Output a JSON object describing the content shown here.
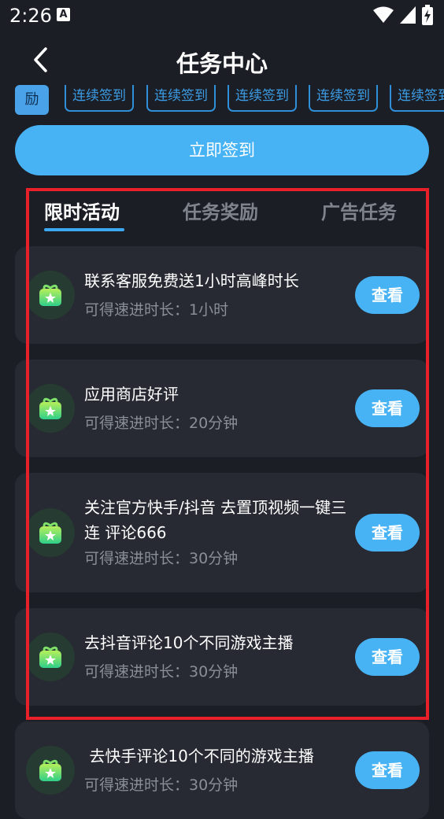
{
  "status": {
    "time": "2:26",
    "notification_icon": "A"
  },
  "header": {
    "title": "任务中心"
  },
  "chips": {
    "first": "励",
    "items": [
      "连续签到",
      "连续签到",
      "连续签到",
      "连续签到",
      "连续签到"
    ]
  },
  "signin": {
    "label": "立即签到"
  },
  "tabs": [
    {
      "label": "限时活动",
      "active": true
    },
    {
      "label": "任务奖励",
      "active": false
    },
    {
      "label": "广告任务",
      "active": false
    }
  ],
  "tasks": [
    {
      "title": "联系客服免费送1小时高峰时长",
      "reward": "可得速进时长：1小时",
      "button": "查看"
    },
    {
      "title": "应用商店好评",
      "reward": "可得速进时长：20分钟",
      "button": "查看"
    },
    {
      "title": "关注官方快手/抖音 去置顶视频一键三连 评论666",
      "reward": "可得速进时长：30分钟",
      "button": "查看"
    },
    {
      "title": "去抖音评论10个不同游戏主播",
      "reward": "可得速进时长：30分钟",
      "button": "查看"
    },
    {
      "title": " 去快手评论10个不同的游戏主播",
      "reward": "可得速进时长：30分钟",
      "button": "查看"
    }
  ],
  "colors": {
    "accent": "#47b3f5",
    "highlight_border": "#e8202a",
    "card": "#272a33",
    "background": "#1c1e26"
  }
}
